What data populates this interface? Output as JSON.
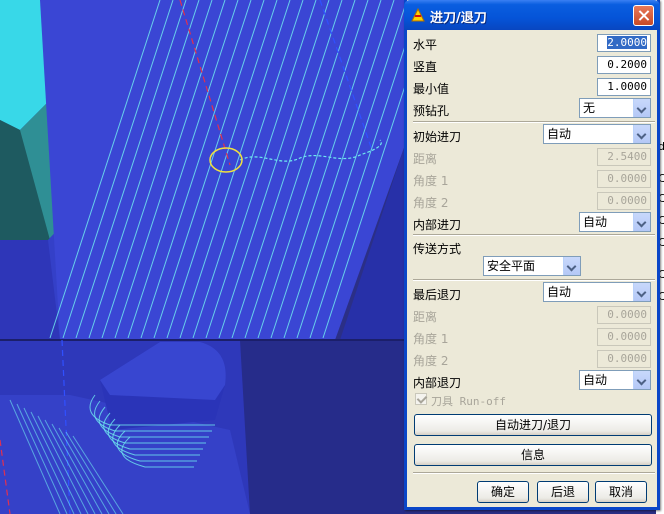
{
  "dialog": {
    "title": "进刀/退刀",
    "horizontal": {
      "label": "水平",
      "value": "2.0000"
    },
    "vertical": {
      "label": "竖直",
      "value": "0.2000"
    },
    "minimum": {
      "label": "最小值",
      "value": "1.0000"
    },
    "predrill": {
      "label": "预钻孔",
      "selected": "无"
    },
    "initial_lead_in": {
      "label": "初始进刀",
      "selected": "自动"
    },
    "in_distance": {
      "label": "距离",
      "value": "2.5400"
    },
    "in_angle1": {
      "label": "角度 1",
      "value": "0.0000"
    },
    "in_angle2": {
      "label": "角度 2",
      "value": "0.0000"
    },
    "internal_lead_in": {
      "label": "内部进刀",
      "selected": "自动"
    },
    "transfer": {
      "label": "传送方式",
      "selected": "安全平面"
    },
    "final_lead_out": {
      "label": "最后退刀",
      "selected": "自动"
    },
    "out_distance": {
      "label": "距离",
      "value": "0.0000"
    },
    "out_angle1": {
      "label": "角度 1",
      "value": "0.0000"
    },
    "out_angle2": {
      "label": "角度 2",
      "value": "0.0000"
    },
    "internal_lead_out": {
      "label": "内部退刀",
      "selected": "自动"
    },
    "tool_runoff": {
      "label": "刀具 Run-off",
      "checked": true
    },
    "auto_button": "自动进刀/退刀",
    "info_button": "信息",
    "ok_button": "确定",
    "back_button": "后退",
    "cancel_button": "取消"
  },
  "colors": {
    "titlebar": "#0554d8",
    "dialog_bg": "#ece9d8",
    "viewport_bg": "#2a2f7e",
    "toolpath": "#6fe8f0"
  },
  "background_strip_chars": [
    "d",
    "l",
    "C",
    "C",
    "C",
    "C",
    "C",
    "C"
  ]
}
